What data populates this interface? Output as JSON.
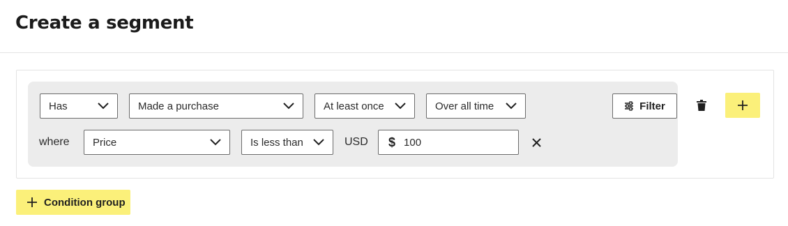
{
  "header": {
    "title": "Create a segment"
  },
  "condition": {
    "has_select": "Has",
    "event_select": "Made a purchase",
    "frequency_select": "At least once",
    "time_select": "Over all time",
    "filter_label": "Filter",
    "where_label": "where",
    "property_select": "Price",
    "operator_select": "Is less than",
    "currency_label": "USD",
    "currency_symbol": "$",
    "amount_value": "100"
  },
  "actions": {
    "condition_group_label": "Condition group"
  },
  "icons": {
    "chevron": "chevron-down-icon",
    "filter": "sliders-icon",
    "trash": "trash-icon",
    "plus": "plus-icon",
    "close": "close-icon"
  },
  "colors": {
    "accent_yellow": "#fbf07a",
    "panel_gray": "#ececec",
    "border": "#6b6b6b"
  }
}
